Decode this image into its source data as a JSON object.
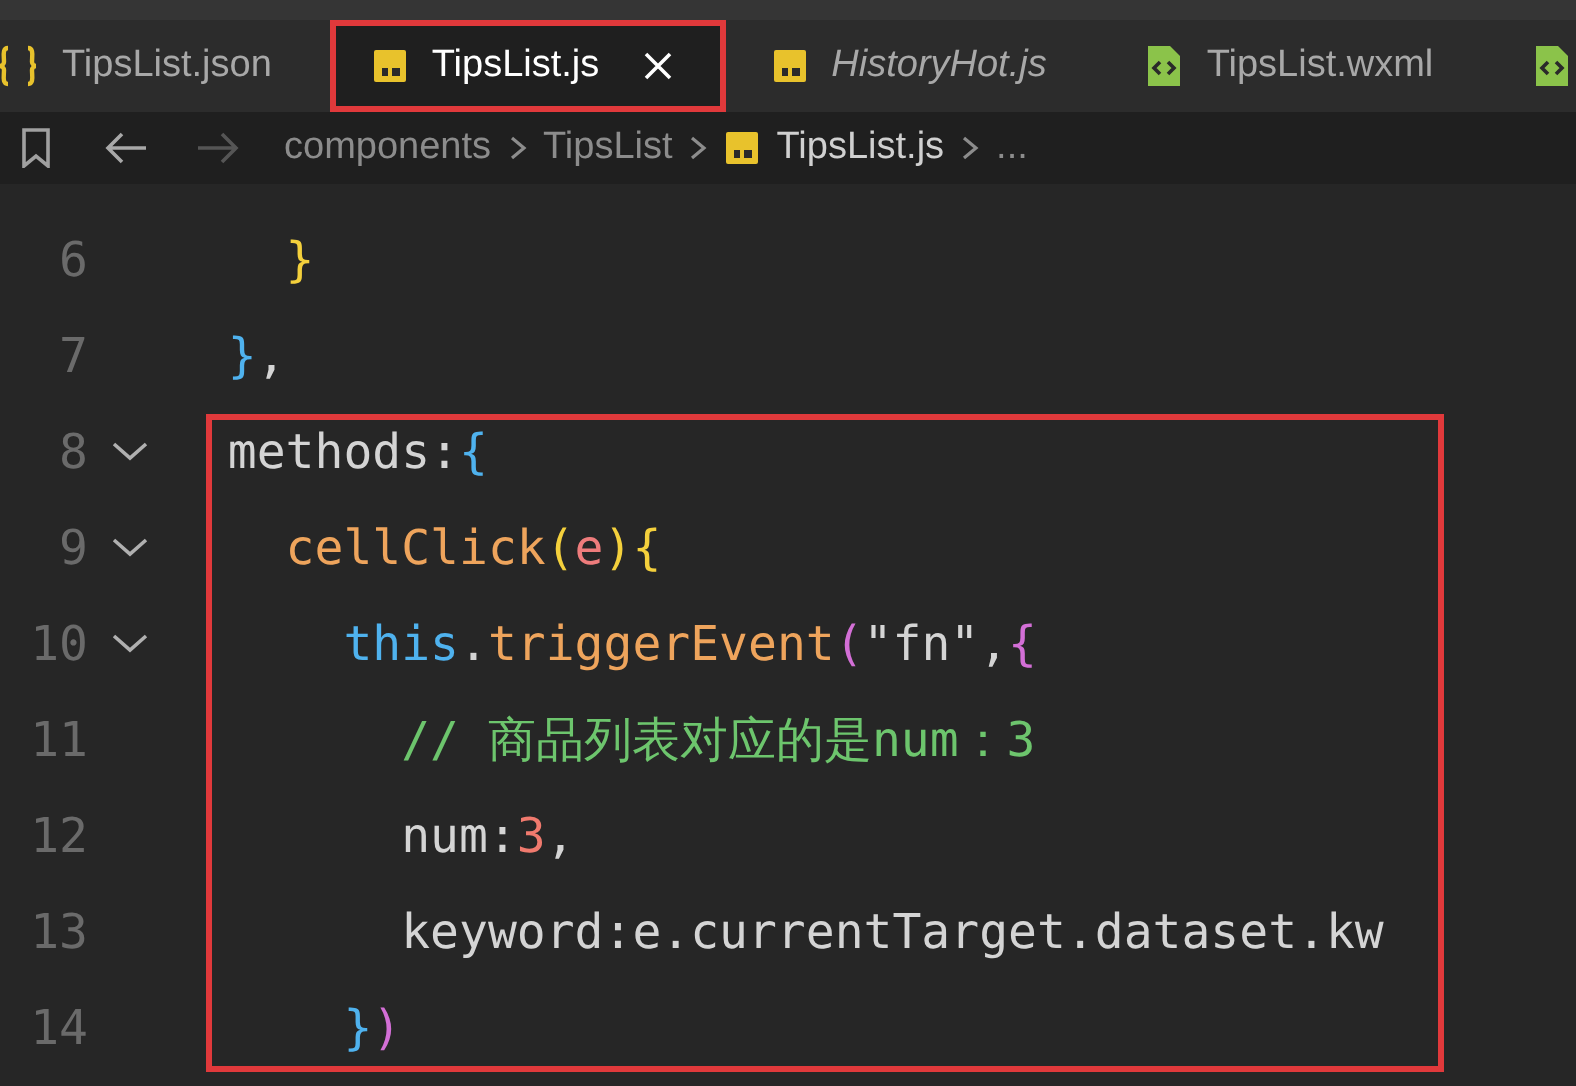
{
  "tabs": [
    {
      "kind": "json",
      "label": "TipsList.json",
      "selected": false,
      "preview": false,
      "highlighted": false
    },
    {
      "kind": "js",
      "label": "TipsList.js",
      "selected": true,
      "preview": false,
      "highlighted": true
    },
    {
      "kind": "js",
      "label": "HistoryHot.js",
      "selected": false,
      "preview": true,
      "highlighted": false
    },
    {
      "kind": "wxml",
      "label": "TipsList.wxml",
      "selected": false,
      "preview": false,
      "highlighted": false
    },
    {
      "kind": "wxml",
      "selected": false,
      "preview": false,
      "highlighted": false
    }
  ],
  "breadcrumb": {
    "back_disabled": false,
    "forward_disabled": true,
    "items": [
      {
        "kind": "folder",
        "text": "components"
      },
      {
        "kind": "folder",
        "text": "TipsList"
      },
      {
        "kind": "js",
        "text": "TipsList.js"
      },
      {
        "kind": "more",
        "text": "..."
      }
    ]
  },
  "code_blocks": [
    {
      "framed": false,
      "lines": [
        {
          "number": "6",
          "tokens": [
            {
              "kind": "bracket-yellow",
              "text": "    }"
            }
          ]
        },
        {
          "number": "7",
          "tokens": [
            {
              "kind": "bracket-blue",
              "text": "  }"
            },
            {
              "kind": "plain",
              "text": ","
            }
          ]
        }
      ]
    },
    {
      "framed": true,
      "lines": [
        {
          "number": "8",
          "expanded": true,
          "tokens": [
            {
              "kind": "plain",
              "text": "  methods:"
            },
            {
              "kind": "bracket-blue",
              "text": "{"
            }
          ]
        },
        {
          "number": "9",
          "expanded": true,
          "tokens": [
            {
              "kind": "func",
              "text": "    cellClick"
            },
            {
              "kind": "bracket-yellow",
              "text": "("
            },
            {
              "kind": "param",
              "text": "e"
            },
            {
              "kind": "bracket-yellow",
              "text": ")"
            },
            {
              "kind": "bracket-yellow",
              "text": "{"
            }
          ]
        },
        {
          "number": "10",
          "expanded": true,
          "tokens": [
            {
              "kind": "keyword",
              "text": "      this"
            },
            {
              "kind": "plain",
              "text": "."
            },
            {
              "kind": "func",
              "text": "triggerEvent"
            },
            {
              "kind": "bracket-purple",
              "text": "("
            },
            {
              "kind": "plain",
              "text": "\"fn\","
            },
            {
              "kind": "bracket-purple",
              "text": "{"
            }
          ]
        },
        {
          "number": "11",
          "tokens": [
            {
              "kind": "comment",
              "text": "        // 商品列表对应的是num：3"
            }
          ]
        },
        {
          "number": "12",
          "tokens": [
            {
              "kind": "plain",
              "text": "        num:"
            },
            {
              "kind": "number",
              "text": "3"
            },
            {
              "kind": "plain",
              "text": ","
            }
          ]
        },
        {
          "number": "13",
          "tokens": [
            {
              "kind": "plain",
              "text": "        keyword:e.currentTarget.dataset.kw"
            }
          ]
        },
        {
          "number": "14",
          "tokens": [
            {
              "kind": "bracket-blue",
              "text": "      }"
            },
            {
              "kind": "bracket-purple",
              "text": ")"
            }
          ]
        }
      ]
    }
  ]
}
